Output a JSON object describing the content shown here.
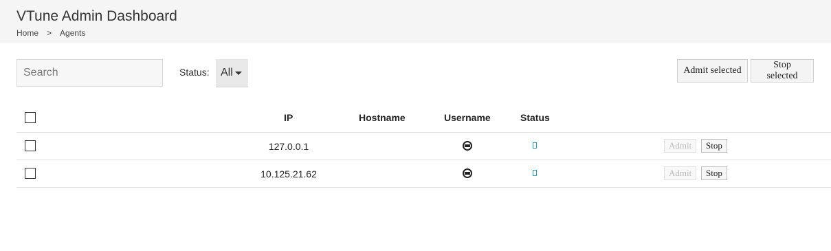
{
  "app": {
    "title": "VTune Admin Dashboard"
  },
  "breadcrumb": {
    "home": "Home",
    "separator": ">",
    "current": "Agents"
  },
  "toolbar": {
    "search_placeholder": "Search",
    "status_label": "Status:",
    "status_value": "All",
    "admit_selected": "Admit selected",
    "stop_selected": "Stop selected"
  },
  "table": {
    "columns": {
      "ip": "IP",
      "hostname": "Hostname",
      "username": "Username",
      "status": "Status"
    },
    "rows": [
      {
        "ip": "127.0.0.1",
        "hostname": "",
        "admit": "Admit",
        "stop": "Stop"
      },
      {
        "ip": "10.125.21.62",
        "hostname": "",
        "admit": "Admit",
        "stop": "Stop"
      }
    ]
  },
  "colors": {
    "header_bg": "#f5f5f6",
    "status_icon": "#1e9ad6"
  },
  "icons": {
    "username": "user-icon",
    "status": "status-icon"
  }
}
